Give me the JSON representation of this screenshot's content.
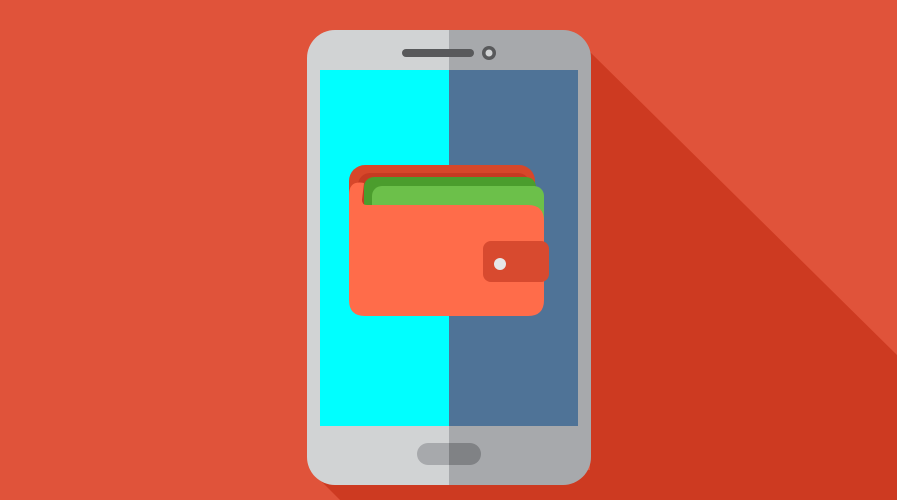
{
  "scene": {
    "subject": "phone-wallet-illustration",
    "icons": [
      "smartphone-icon",
      "wallet-icon",
      "speaker-grille",
      "front-camera",
      "home-button",
      "wallet-clasp",
      "wallet-snap-button",
      "banknote",
      "long-shadow"
    ],
    "colors": {
      "background": "#e0533a",
      "long_shadow": "#cd3a21",
      "phone_body_left": "#d1d3d4",
      "phone_body_right": "#a7a9ac",
      "screen_left": "#00ffff",
      "screen_right": "#4f7397",
      "speaker": "#58595b",
      "camera_ring": "#58595b",
      "camera_lens": "#d1d3d4",
      "home_button_left": "#a7a9ac",
      "home_button_right": "#808285",
      "wallet_body": "#ff6c4a",
      "wallet_back": "#d7472a",
      "wallet_lining": "#c63a22",
      "note_back": "#4b9d2d",
      "note_front": "#6cc04a",
      "clasp": "#d84a2f",
      "snap_button": "#e6e7e8"
    }
  }
}
